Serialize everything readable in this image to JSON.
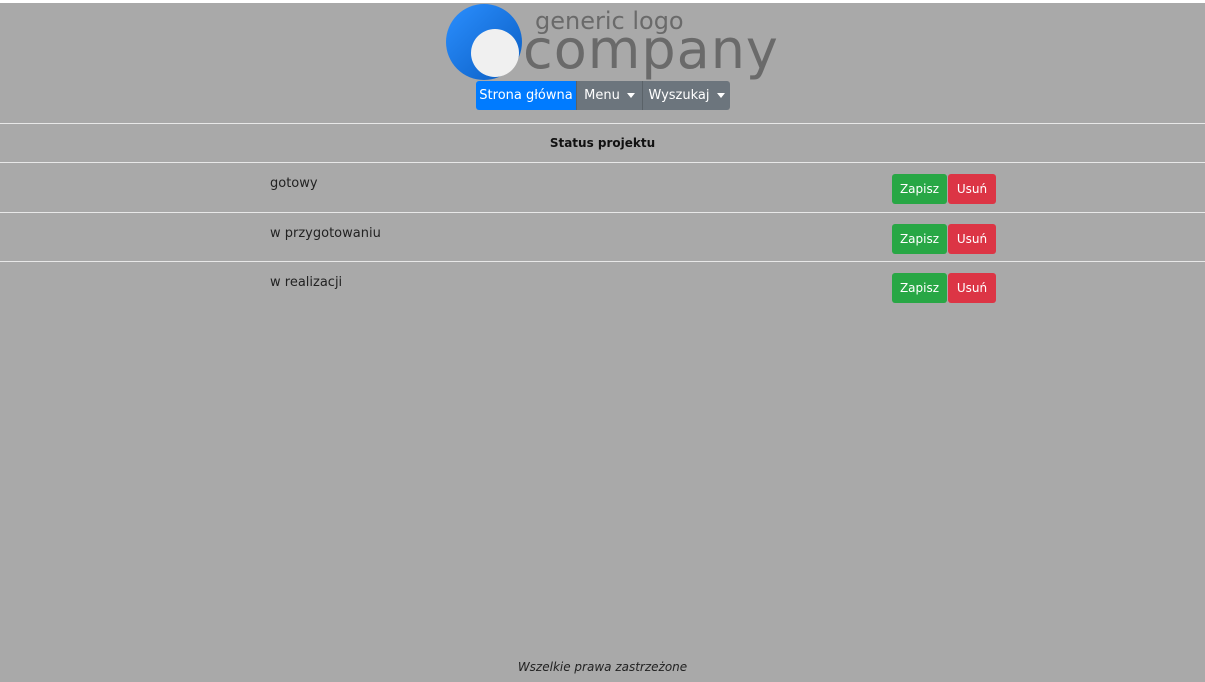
{
  "logo": {
    "small_text": "generic logo",
    "big_text": "company",
    "colors": {
      "circle": "#1a7ae0",
      "inner": "#f0f0f0",
      "text": "#6a6a6a"
    }
  },
  "nav": {
    "home_label": "Strona główna",
    "menu_label": "Menu",
    "search_label": "Wyszukaj"
  },
  "table": {
    "title": "Status projektu",
    "rows": [
      {
        "label": "gotowy",
        "save_label": "Zapisz",
        "delete_label": "Usuń"
      },
      {
        "label": "w przygotowaniu",
        "save_label": "Zapisz",
        "delete_label": "Usuń"
      },
      {
        "label": "w realizacji",
        "save_label": "Zapisz",
        "delete_label": "Usuń"
      }
    ]
  },
  "footer": {
    "text": "Wszelkie prawa zastrzeżone"
  },
  "colors": {
    "background": "#a9a9a9",
    "primary": "#007bff",
    "secondary": "#6c757d",
    "success": "#28a745",
    "danger": "#dc3545"
  }
}
